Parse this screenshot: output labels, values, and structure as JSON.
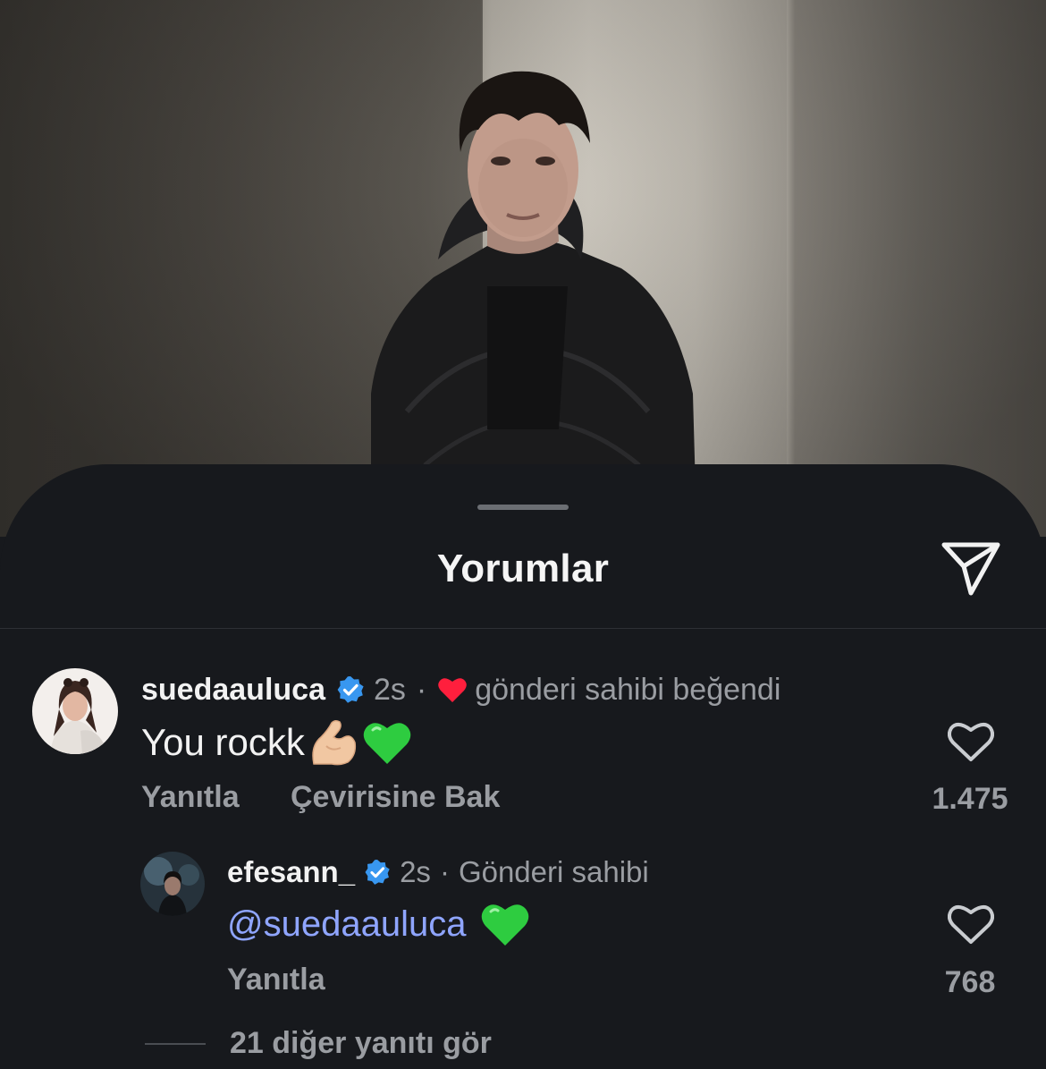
{
  "sheet": {
    "title": "Yorumlar",
    "share_icon": "paper-plane-icon"
  },
  "comments": [
    {
      "username": "suedaauluca",
      "verified": true,
      "time": "2s",
      "separator": "·",
      "liked_by_author_icon": "heart-filled-icon",
      "liked_by_author_text": "gönderi sahibi beğendi",
      "text": "You rockk",
      "emojis": [
        "flexed-biceps",
        "green-heart"
      ],
      "reply_label": "Yanıtla",
      "translate_label": "Çevirisine Bak",
      "like_count": "1.475",
      "replies": [
        {
          "username": "efesann_",
          "verified": true,
          "time": "2s",
          "separator": "·",
          "author_tag": "Gönderi sahibi",
          "mention": "@suedaauluca",
          "emojis": [
            "green-heart"
          ],
          "reply_label": "Yanıtla",
          "like_count": "768"
        }
      ],
      "more_replies_label": "21 diğer yanıtı gör"
    }
  ],
  "colors": {
    "sheet_bg": "#17191d",
    "text_primary": "#f2f2f2",
    "text_secondary": "#9a9da2",
    "mention": "#8fa5ff",
    "verified": "#3897f0",
    "heart_red": "#ff1f3d",
    "green_heart": "#2ecc40"
  }
}
